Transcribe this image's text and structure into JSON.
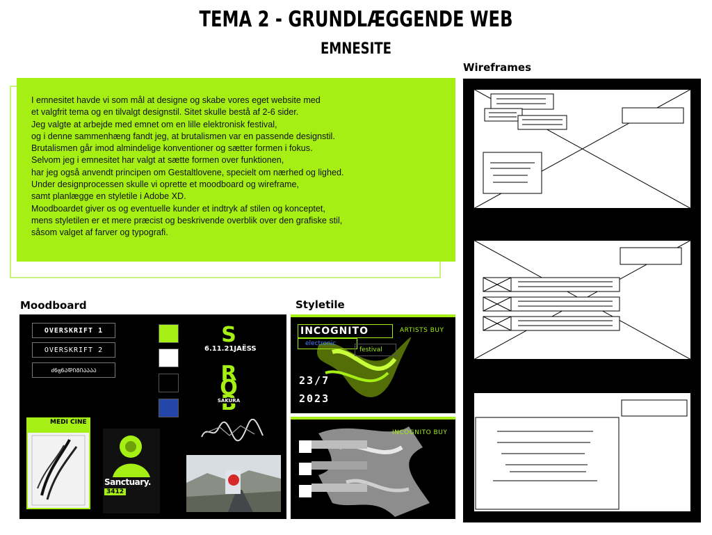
{
  "header": {
    "title": "TEMA 2 - GRUNDLÆGGENDE WEB",
    "subtitle": "EMNESITE"
  },
  "intro": {
    "lines": [
      "I emnesitet havde vi som mål at designe og skabe vores eget website med",
      "et valgfrit tema og en tilvalgt designstil. Sitet skulle bestå af 2-6 sider.",
      "Jeg valgte at arbejde med emnet om en lille elektronisk festival,",
      "og i denne sammenhæng fandt jeg, at brutalismen var en passende designstil.",
      "Brutalismen går imod almindelige konventioner og sætter formen i fokus.",
      "Selvom jeg i emnesitet har valgt at sætte formen over funktionen,",
      "har jeg også anvendt principen om Gestaltlovene, specielt om nærhed og lighed.",
      "Under designprocessen skulle vi oprette et moodboard og wireframe,",
      "samt planlægge en styletile i Adobe XD.",
      "Moodboardet giver os og eventuelle kunder et indtryk af stilen og konceptet,",
      "mens styletilen er et mere præcist og beskrivende overblik over den grafiske stil,",
      "såsom valget af farver og typografi."
    ]
  },
  "sections": {
    "wireframes": "Wireframes",
    "moodboard": "Moodboard",
    "styletile": "Styletile"
  },
  "moodboard": {
    "button1": "OVERSKRIFT 1",
    "button2": "OVERSKRIFT 2",
    "button3": "ძ6ფ6ᲐᲓᲘᲒᲘᲐᲐᲐᲐ",
    "swatches": [
      "#a6ef14",
      "#ffffff",
      "#000000",
      "#2346a8"
    ],
    "strobo_letters": [
      "S",
      "R",
      "O",
      "B",
      "O"
    ],
    "strobo_date": "6.11.21",
    "strobo_artist": "JAËSS",
    "strobo_footer": "SAKURA",
    "medicine": "MEDI CINE",
    "sanctuary": "Sanctuary.",
    "sanctuary_num": "3412"
  },
  "styletile": {
    "logo": "INCOGNITO",
    "artists_buy": "ARTISTS BUY",
    "electronic": "electronic",
    "festival": "festival",
    "date1": "23/7",
    "date2": "2023",
    "incognito_buy": "INCOGNITO BUY"
  }
}
